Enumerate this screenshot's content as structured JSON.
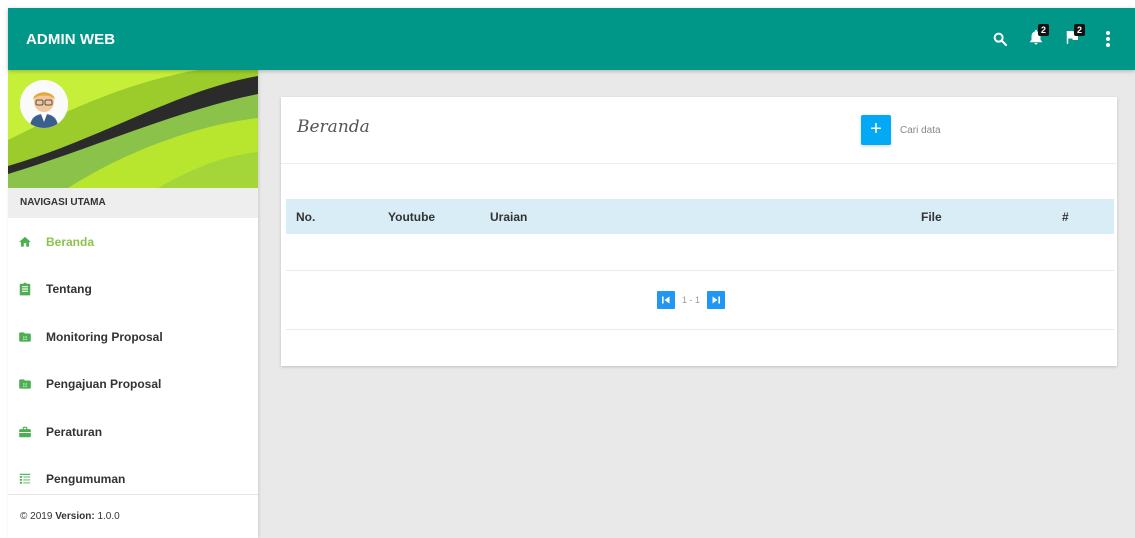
{
  "header": {
    "brand": "ADMIN WEB",
    "notifications_count": "2",
    "flags_count": "2",
    "icons": [
      "search-icon",
      "bell-icon",
      "flag-icon",
      "more-vert-icon"
    ]
  },
  "sidebar": {
    "section_title": "NAVIGASI UTAMA",
    "items": [
      {
        "label": "Beranda",
        "icon": "home-icon",
        "active": true
      },
      {
        "label": "Tentang",
        "icon": "clipboard-icon"
      },
      {
        "label": "Monitoring Proposal",
        "icon": "folder-icon"
      },
      {
        "label": "Pengajuan Proposal",
        "icon": "folder-icon"
      },
      {
        "label": "Peraturan",
        "icon": "briefcase-icon"
      },
      {
        "label": "Pengumuman",
        "icon": "view-list-icon"
      }
    ],
    "footer_copyright": "© 2019",
    "footer_version_label": "Version:",
    "footer_version": "1.0.0"
  },
  "main": {
    "title": "Beranda",
    "add_label": "+",
    "search_placeholder": "Cari data",
    "columns": [
      "No.",
      "Youtube",
      "Uraian",
      "File",
      "#"
    ],
    "rows": [],
    "pager_text": "1 - 1"
  },
  "colors": {
    "header_bg": "#009688",
    "active_menu": "#8bc34a",
    "menu_icon": "#4caf50",
    "table_head_bg": "#d9edf7",
    "add_button": "#03a9f4",
    "pager_button": "#2196f3"
  }
}
